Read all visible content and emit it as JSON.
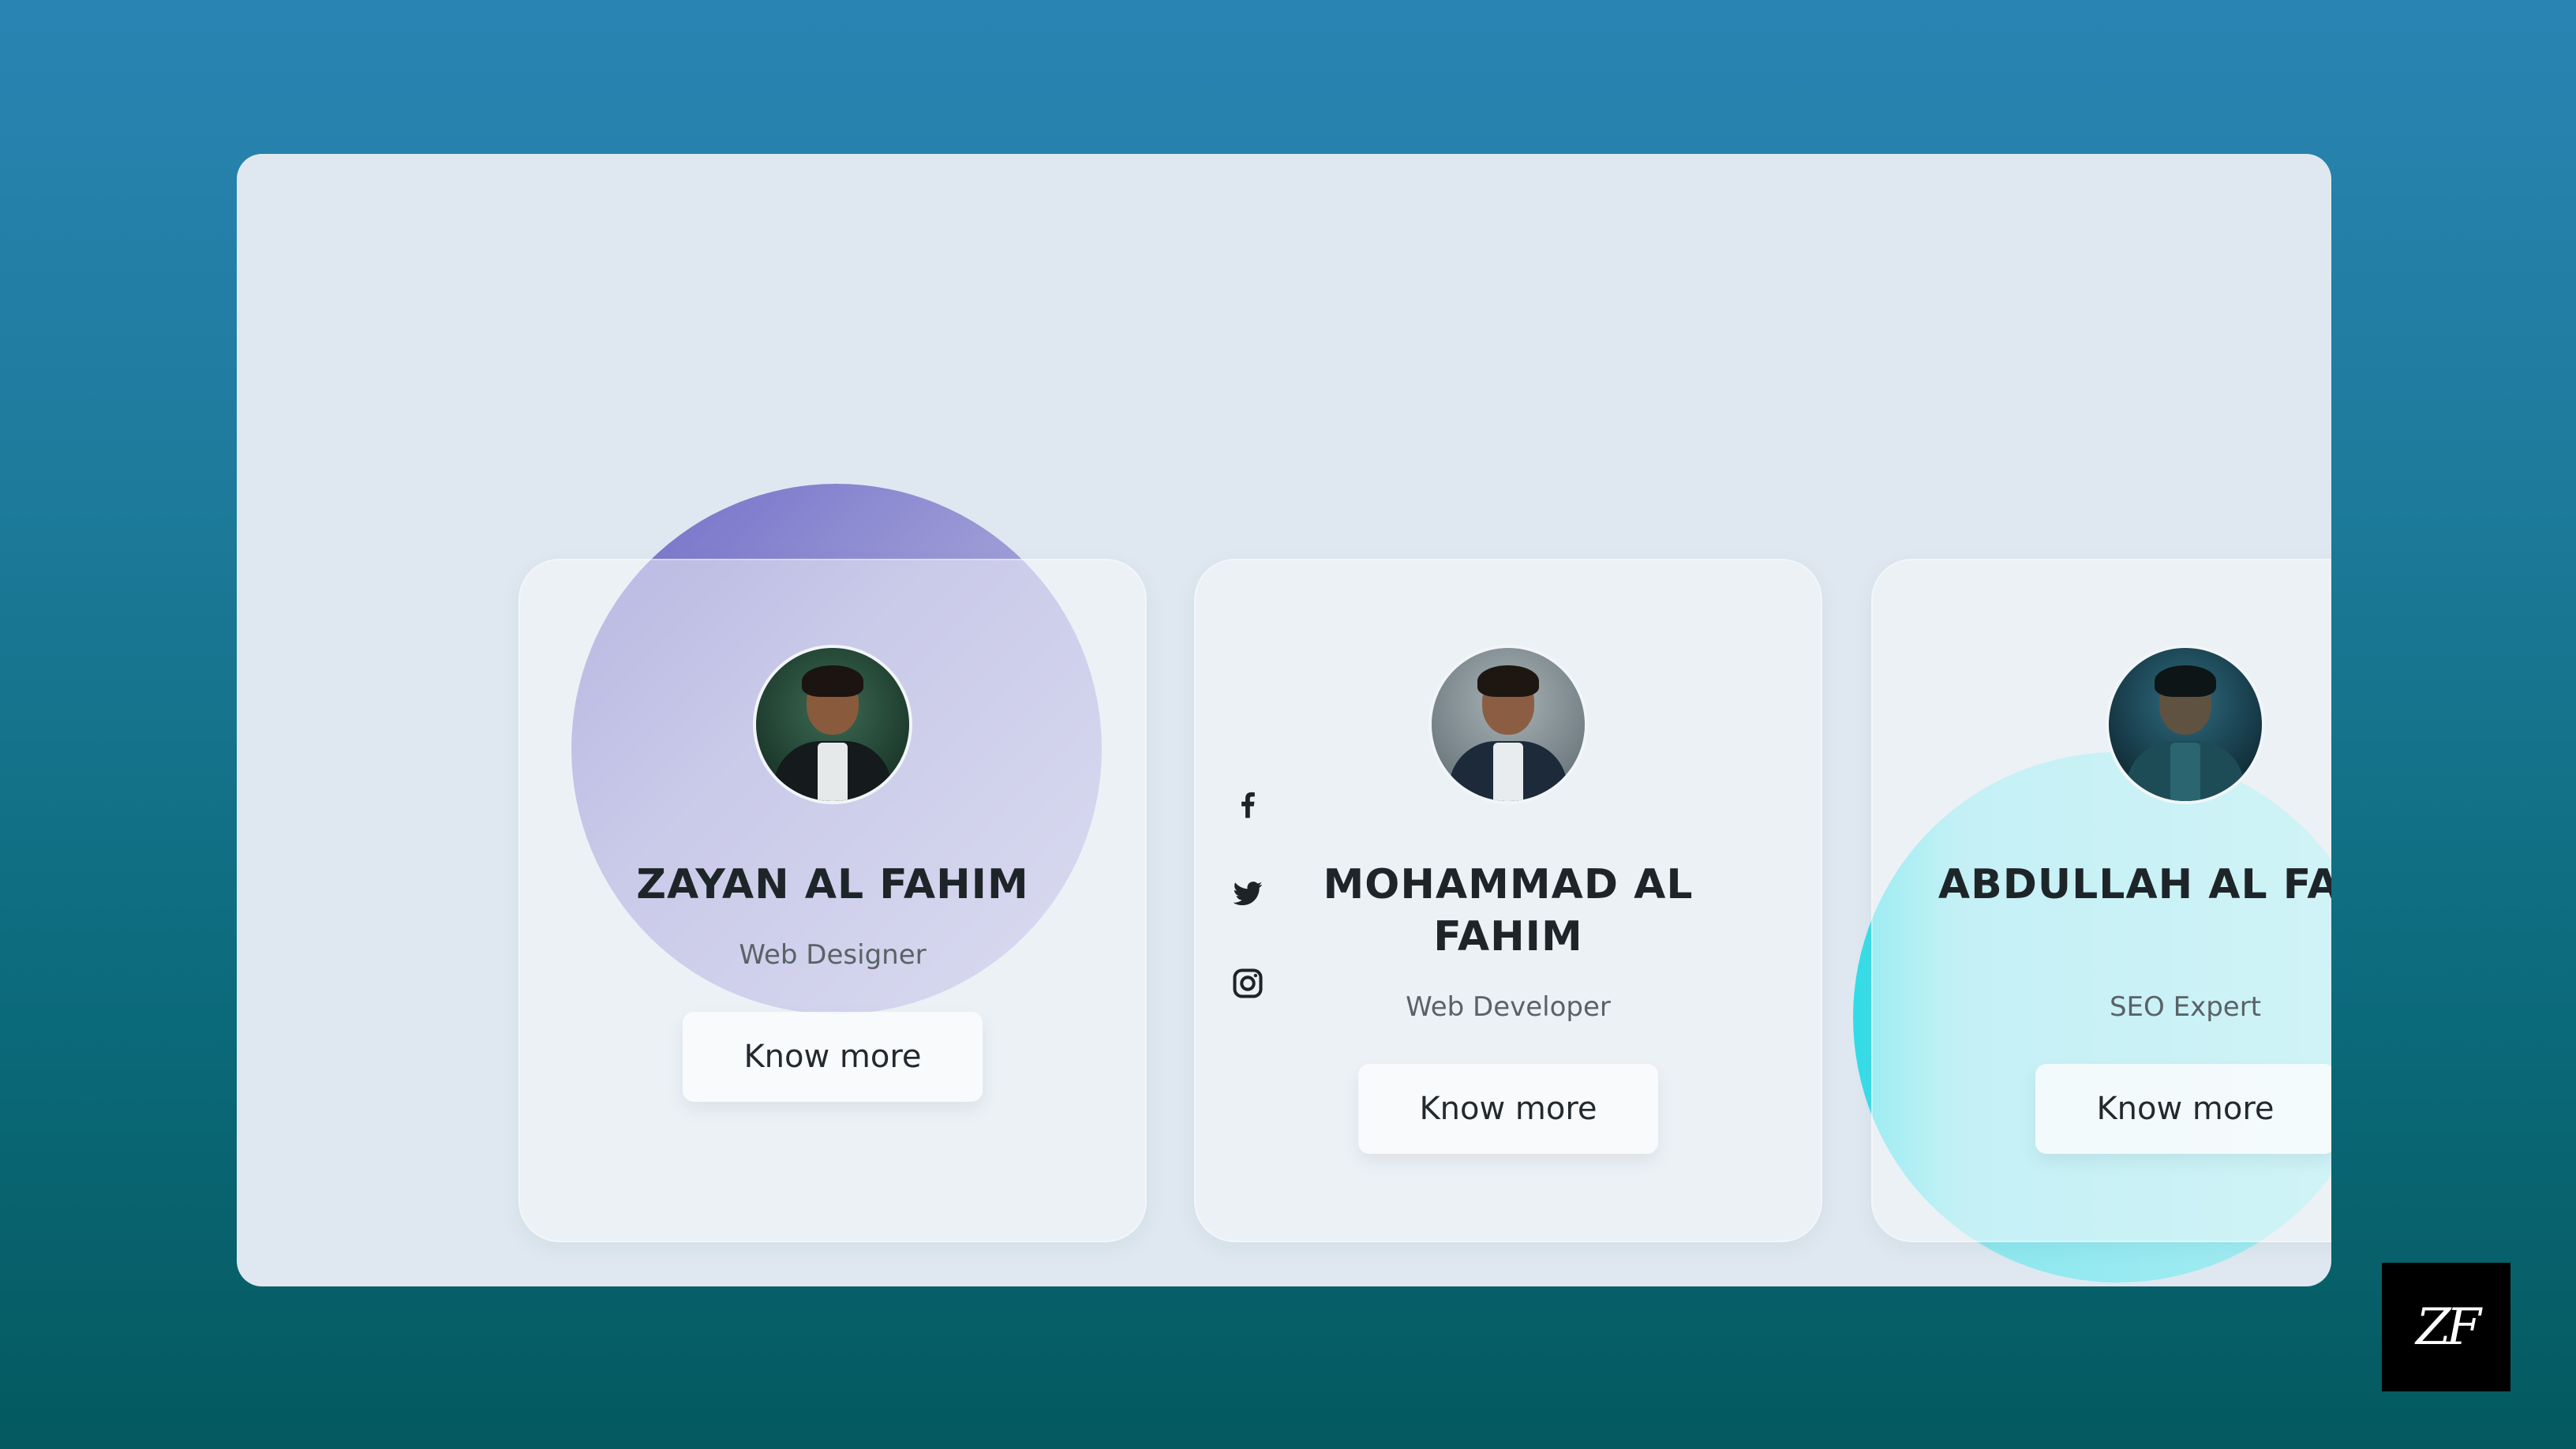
{
  "colors": {
    "background_top": "#2a84b3",
    "background_bottom": "#04595f",
    "panel": "#dfe8f0",
    "accent_purple": "#8f8dd3",
    "accent_cyan": "#8de7ef"
  },
  "team": [
    {
      "name": "ZAYAN AL FAHIM",
      "role": "Web Designer",
      "button_label": "Know more",
      "avatar_icon": "person-photo"
    },
    {
      "name": "MOHAMMAD AL FAHIM",
      "role": "Web Developer",
      "button_label": "Know more",
      "avatar_icon": "person-photo",
      "social_icons": [
        "facebook-icon",
        "twitter-icon",
        "instagram-icon"
      ]
    },
    {
      "name": "ABDULLAH AL FAHIM",
      "role": "SEO Expert",
      "button_label": "Know more",
      "avatar_icon": "person-photo"
    }
  ],
  "logo": {
    "text": "ZF"
  }
}
